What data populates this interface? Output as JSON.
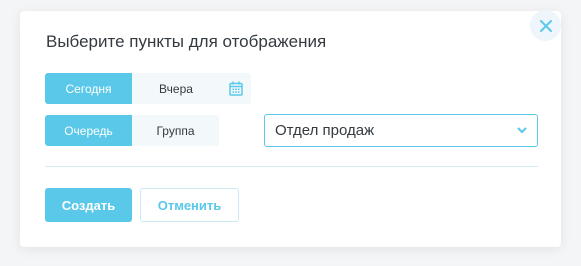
{
  "dialog": {
    "title": "Выберите пункты для отображения"
  },
  "day_toggle": {
    "today_label": "Сегодня",
    "yesterday_label": "Вчера",
    "selected": "Сегодня",
    "calendar_icon": "calendar-icon"
  },
  "type_toggle": {
    "queue_label": "Очередь",
    "group_label": "Группа",
    "selected": "Очередь"
  },
  "department_select": {
    "value": "Отдел продаж",
    "icon": "chevron-down-icon"
  },
  "actions": {
    "create_label": "Создать",
    "cancel_label": "Отменить"
  },
  "close": {
    "icon": "close-icon"
  },
  "colors": {
    "accent": "#5ac8e8",
    "text": "#333a40",
    "segment_bg": "#f3f8fb"
  }
}
